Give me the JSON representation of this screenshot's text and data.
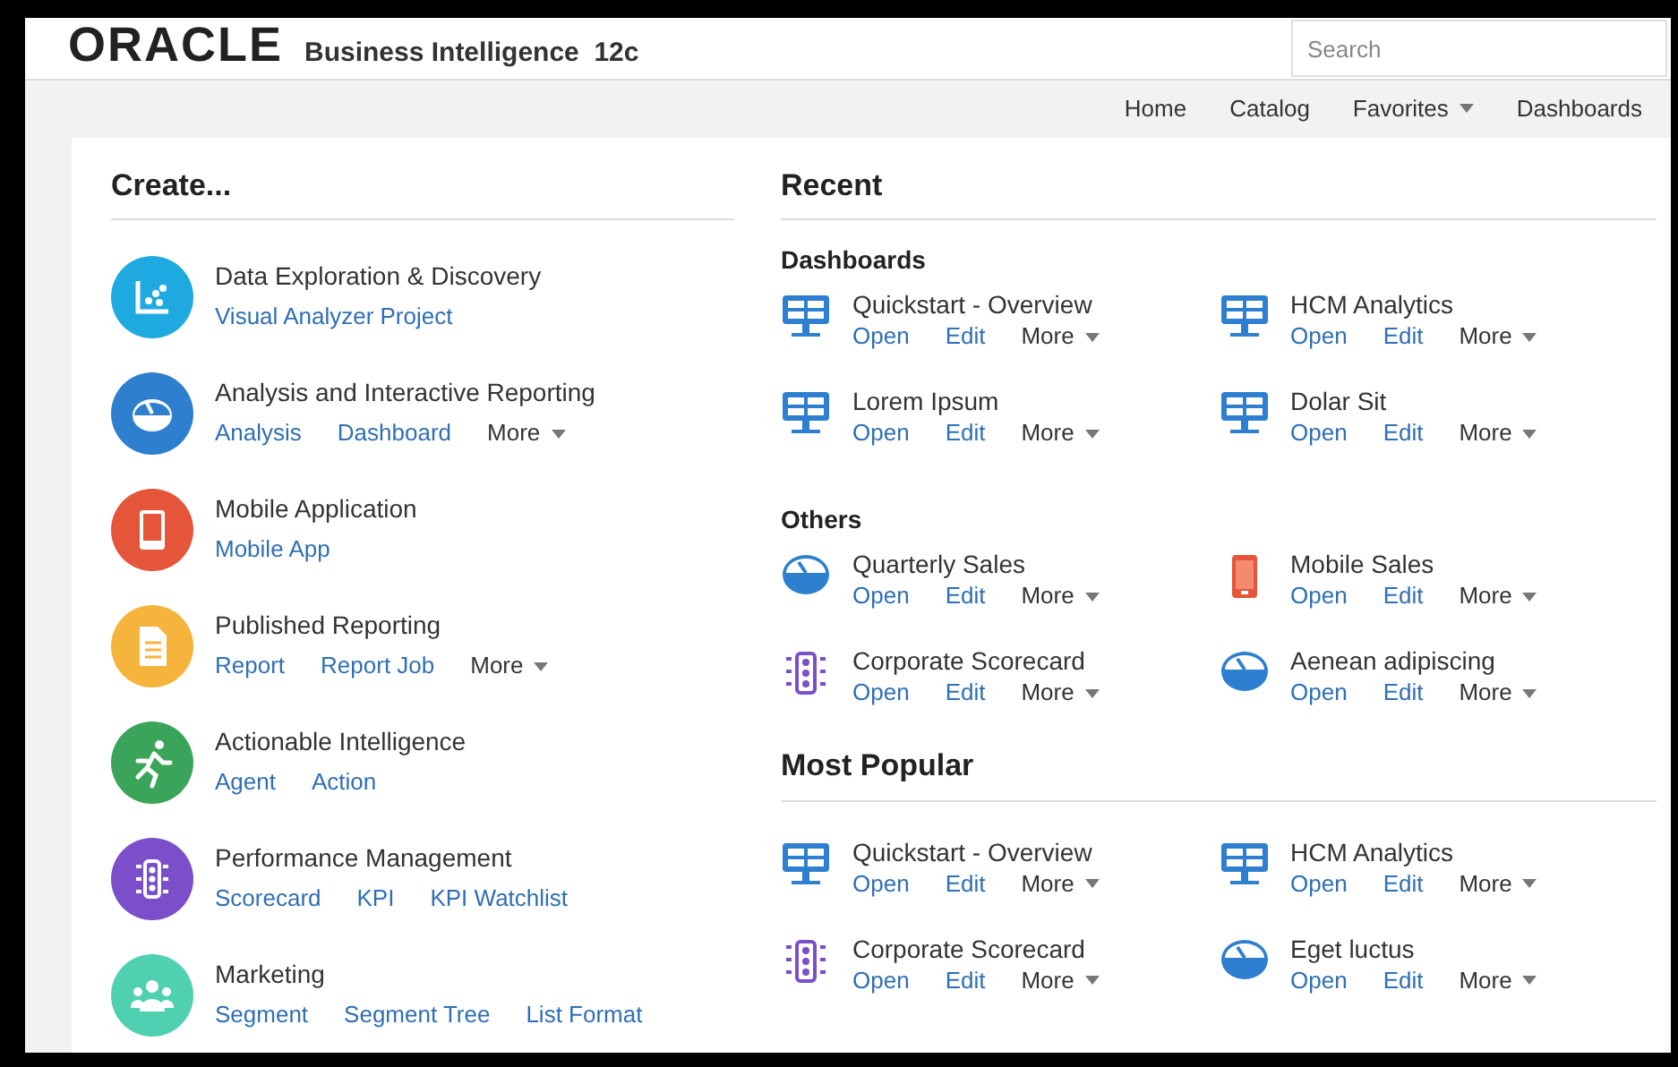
{
  "header": {
    "brand": "ORACLE",
    "product": "Business Intelligence  12c",
    "search": {
      "placeholder": "Search"
    }
  },
  "nav": [
    {
      "label": "Home",
      "dropdown": false
    },
    {
      "label": "Catalog",
      "dropdown": false
    },
    {
      "label": "Favorites",
      "dropdown": true
    },
    {
      "label": "Dashboards",
      "dropdown": false
    }
  ],
  "create": {
    "title": "Create...",
    "items": [
      {
        "title": "Data Exploration & Discovery",
        "kind": "chart",
        "color": "#1fa9e1",
        "links": [
          {
            "label": "Visual Analyzer Project",
            "kind": "link"
          }
        ]
      },
      {
        "title": "Analysis and Interactive Reporting",
        "kind": "gauge",
        "color": "#2f7fcf",
        "links": [
          {
            "label": "Analysis",
            "kind": "link"
          },
          {
            "label": "Dashboard",
            "kind": "link"
          },
          {
            "label": "More",
            "kind": "more"
          }
        ]
      },
      {
        "title": "Mobile Application",
        "kind": "mobile",
        "color": "#e5553a",
        "links": [
          {
            "label": "Mobile App",
            "kind": "link"
          }
        ]
      },
      {
        "title": "Published Reporting",
        "kind": "document",
        "color": "#f5b43c",
        "links": [
          {
            "label": "Report",
            "kind": "link"
          },
          {
            "label": "Report Job",
            "kind": "link"
          },
          {
            "label": "More",
            "kind": "more"
          }
        ]
      },
      {
        "title": "Actionable Intelligence",
        "kind": "runner",
        "color": "#3aa55a",
        "links": [
          {
            "label": "Agent",
            "kind": "link"
          },
          {
            "label": "Action",
            "kind": "link"
          }
        ]
      },
      {
        "title": "Performance Management",
        "kind": "scorecard",
        "color": "#7a4fc9",
        "links": [
          {
            "label": "Scorecard",
            "kind": "link"
          },
          {
            "label": "KPI",
            "kind": "link"
          },
          {
            "label": "KPI Watchlist",
            "kind": "link"
          }
        ]
      },
      {
        "title": "Marketing",
        "kind": "people",
        "color": "#4fd0b0",
        "links": [
          {
            "label": "Segment",
            "kind": "link"
          },
          {
            "label": "Segment Tree",
            "kind": "link"
          },
          {
            "label": "List Format",
            "kind": "link"
          }
        ]
      }
    ]
  },
  "recent": {
    "title": "Recent",
    "sections": [
      {
        "title": "Dashboards",
        "items": [
          {
            "name": "Quickstart - Overview",
            "kind": "dashboard",
            "actions": [
              {
                "label": "Open",
                "kind": "link"
              },
              {
                "label": "Edit",
                "kind": "link"
              },
              {
                "label": "More",
                "kind": "more"
              }
            ]
          },
          {
            "name": "HCM Analytics",
            "kind": "dashboard",
            "actions": [
              {
                "label": "Open",
                "kind": "link"
              },
              {
                "label": "Edit",
                "kind": "link"
              },
              {
                "label": "More",
                "kind": "more"
              }
            ]
          },
          {
            "name": "Lorem Ipsum",
            "kind": "dashboard",
            "actions": [
              {
                "label": "Open",
                "kind": "link"
              },
              {
                "label": "Edit",
                "kind": "link"
              },
              {
                "label": "More",
                "kind": "more"
              }
            ]
          },
          {
            "name": "Dolar Sit",
            "kind": "dashboard",
            "actions": [
              {
                "label": "Open",
                "kind": "link"
              },
              {
                "label": "Edit",
                "kind": "link"
              },
              {
                "label": "More",
                "kind": "more"
              }
            ]
          }
        ]
      },
      {
        "title": "Others",
        "items": [
          {
            "name": "Quarterly Sales",
            "kind": "gauge",
            "actions": [
              {
                "label": "Open",
                "kind": "link"
              },
              {
                "label": "Edit",
                "kind": "link"
              },
              {
                "label": "More",
                "kind": "more"
              }
            ]
          },
          {
            "name": "Mobile Sales",
            "kind": "mobile",
            "actions": [
              {
                "label": "Open",
                "kind": "link"
              },
              {
                "label": "Edit",
                "kind": "link"
              },
              {
                "label": "More",
                "kind": "more"
              }
            ]
          },
          {
            "name": "Corporate Scorecard",
            "kind": "scorecard",
            "actions": [
              {
                "label": "Open",
                "kind": "link"
              },
              {
                "label": "Edit",
                "kind": "link"
              },
              {
                "label": "More",
                "kind": "more"
              }
            ]
          },
          {
            "name": "Aenean adipiscing",
            "kind": "gauge",
            "actions": [
              {
                "label": "Open",
                "kind": "link"
              },
              {
                "label": "Edit",
                "kind": "link"
              },
              {
                "label": "More",
                "kind": "more"
              }
            ]
          }
        ]
      }
    ]
  },
  "most_popular": {
    "title": "Most Popular",
    "items": [
      {
        "name": "Quickstart - Overview",
        "kind": "dashboard",
        "actions": [
          {
            "label": "Open",
            "kind": "link"
          },
          {
            "label": "Edit",
            "kind": "link"
          },
          {
            "label": "More",
            "kind": "more"
          }
        ]
      },
      {
        "name": "HCM Analytics",
        "kind": "dashboard",
        "actions": [
          {
            "label": "Open",
            "kind": "link"
          },
          {
            "label": "Edit",
            "kind": "link"
          },
          {
            "label": "More",
            "kind": "more"
          }
        ]
      },
      {
        "name": "Corporate Scorecard",
        "kind": "scorecard",
        "actions": [
          {
            "label": "Open",
            "kind": "link"
          },
          {
            "label": "Edit",
            "kind": "link"
          },
          {
            "label": "More",
            "kind": "more"
          }
        ]
      },
      {
        "name": "Eget luctus",
        "kind": "gauge",
        "actions": [
          {
            "label": "Open",
            "kind": "link"
          },
          {
            "label": "Edit",
            "kind": "link"
          },
          {
            "label": "More",
            "kind": "more"
          }
        ]
      }
    ]
  }
}
